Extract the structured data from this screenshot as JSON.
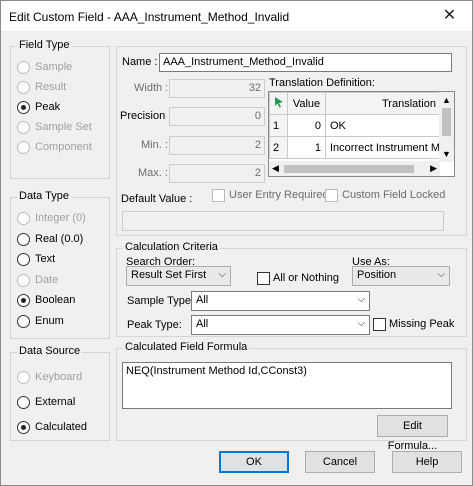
{
  "window": {
    "title": "Edit Custom Field - AAA_Instrument_Method_Invalid",
    "close_glyph": "✕"
  },
  "field_type": {
    "legend": "Field Type",
    "options": [
      {
        "label": "Sample",
        "selected": false,
        "enabled": false
      },
      {
        "label": "Result",
        "selected": false,
        "enabled": false
      },
      {
        "label": "Peak",
        "selected": true,
        "enabled": true
      },
      {
        "label": "Sample Set",
        "selected": false,
        "enabled": false
      },
      {
        "label": "Component",
        "selected": false,
        "enabled": false
      }
    ]
  },
  "data_type": {
    "legend": "Data Type",
    "options": [
      {
        "label": "Integer (0)",
        "selected": false,
        "enabled": false
      },
      {
        "label": "Real (0.0)",
        "selected": false,
        "enabled": true
      },
      {
        "label": "Text",
        "selected": false,
        "enabled": true
      },
      {
        "label": "Date",
        "selected": false,
        "enabled": false
      },
      {
        "label": "Boolean",
        "selected": true,
        "enabled": true
      },
      {
        "label": "Enum",
        "selected": false,
        "enabled": true
      }
    ]
  },
  "data_source": {
    "legend": "Data Source",
    "options": [
      {
        "label": "Keyboard",
        "selected": false,
        "enabled": false
      },
      {
        "label": "External",
        "selected": false,
        "enabled": true
      },
      {
        "label": "Calculated",
        "selected": true,
        "enabled": true
      }
    ]
  },
  "props": {
    "name_label": "Name :",
    "name_value": "AAA_Instrument_Method_Invalid",
    "width_label": "Width :",
    "width_value": "32",
    "precision_label": "Precision :",
    "precision_value": "0",
    "min_label": "Min. :",
    "min_value": "2",
    "max_label": "Max. :",
    "max_value": "2",
    "default_label": "Default Value :",
    "user_entry_label": "User Entry Required",
    "locked_label": "Custom Field Locked"
  },
  "translation": {
    "title": "Translation Definition:",
    "col_value": "Value",
    "col_translation": "Translation",
    "rows": [
      {
        "num": "1",
        "value": "0",
        "translation": "OK"
      },
      {
        "num": "2",
        "value": "1",
        "translation": "Incorrect Instrument Met"
      }
    ]
  },
  "calc": {
    "legend": "Calculation Criteria",
    "search_order_label": "Search Order:",
    "search_order_value": "Result Set First",
    "all_or_nothing_label": "All or Nothing",
    "use_as_label": "Use As:",
    "use_as_value": "Position",
    "sample_type_label": "Sample Type:",
    "sample_type_value": "All",
    "peak_type_label": "Peak Type:",
    "peak_type_value": "All",
    "missing_peak_label": "Missing Peak"
  },
  "formula": {
    "legend": "Calculated Field Formula",
    "text": "NEQ(Instrument Method Id,CConst3)",
    "edit_button": "Edit Formula..."
  },
  "buttons": {
    "ok": "OK",
    "cancel": "Cancel",
    "help": "Help"
  }
}
